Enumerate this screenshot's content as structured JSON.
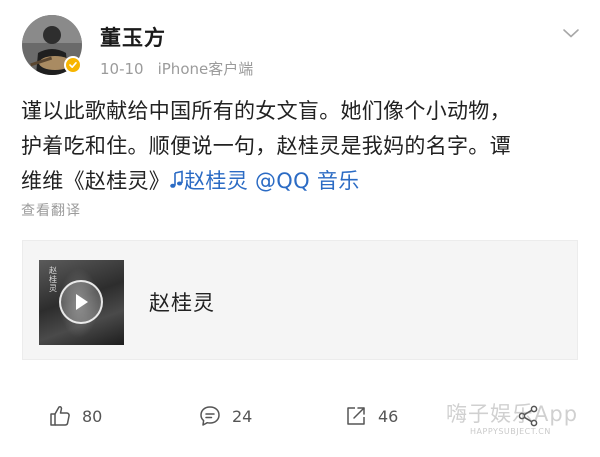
{
  "post": {
    "author": {
      "name": "董玉方",
      "verified": true,
      "badge_color": "#f7b500"
    },
    "meta": {
      "date": "10-10",
      "source": "iPhone客户端"
    },
    "text": {
      "line1": "谨以此歌献给中国所有的女文盲。她们像个小动物，",
      "line2": "护着吃和住。顺便说一句，赵桂灵是我妈的名字。谭",
      "line3_prefix": "维维《赵桂灵》",
      "music_link": "赵桂灵",
      "mention": "@QQ 音乐"
    },
    "translate_label": "查看翻译",
    "music_card": {
      "song_title": "赵桂灵",
      "cover_text": "赵桂灵",
      "play_icon": "play-icon"
    },
    "actions": {
      "likes": "80",
      "comments": "24",
      "reposts": "46"
    },
    "watermark": {
      "main": "嗨子娱乐App",
      "sub": "HAPPYSUBJECT.CN"
    },
    "colors": {
      "link": "#2b6bc4",
      "meta_gray": "#9b9b9b",
      "card_bg": "#f5f5f5"
    }
  }
}
